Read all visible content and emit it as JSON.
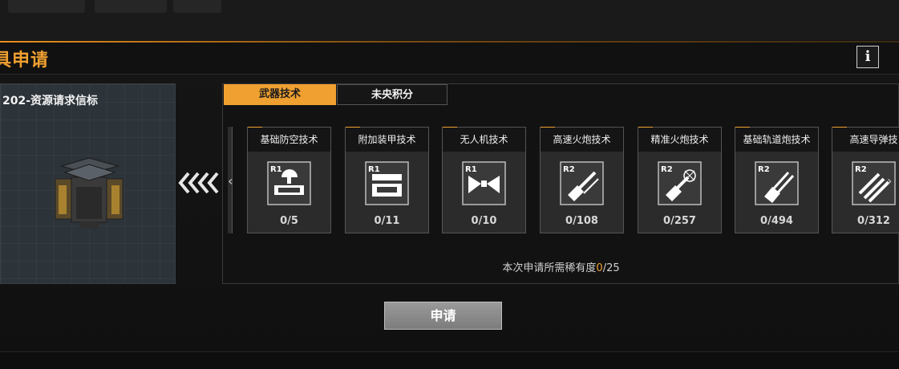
{
  "header": {
    "title": "具申请",
    "info_label": "i"
  },
  "item": {
    "name": "202-资源请求信标",
    "art_icon": "beacon-device-icon"
  },
  "tabs": [
    {
      "label": "武器技术",
      "active": true
    },
    {
      "label": "未央积分",
      "active": false
    }
  ],
  "techs": [
    {
      "name": "基础防空技术",
      "rank": "R1",
      "count": "0/5",
      "icon": "anti-air-icon"
    },
    {
      "name": "附加装甲技术",
      "rank": "R1",
      "count": "0/11",
      "icon": "armor-plate-icon"
    },
    {
      "name": "无人机技术",
      "rank": "R1",
      "count": "0/10",
      "icon": "drone-icon"
    },
    {
      "name": "高速火炮技术",
      "rank": "R2",
      "count": "0/108",
      "icon": "rapid-cannon-icon"
    },
    {
      "name": "精准火炮技术",
      "rank": "R2",
      "count": "0/257",
      "icon": "precision-cannon-icon"
    },
    {
      "name": "基础轨道炮技术",
      "rank": "R2",
      "count": "0/494",
      "icon": "railgun-icon"
    },
    {
      "name": "高速导弹技",
      "rank": "R2",
      "count": "0/312",
      "icon": "missile-icon"
    }
  ],
  "rarity": {
    "prefix": "本次申请所需稀有度",
    "current": "0",
    "suffix": "/25"
  },
  "apply_label": "申请",
  "colors": {
    "accent": "#f0a030",
    "card_bg": "#2b2b2b",
    "button": "#8a8a8a"
  }
}
